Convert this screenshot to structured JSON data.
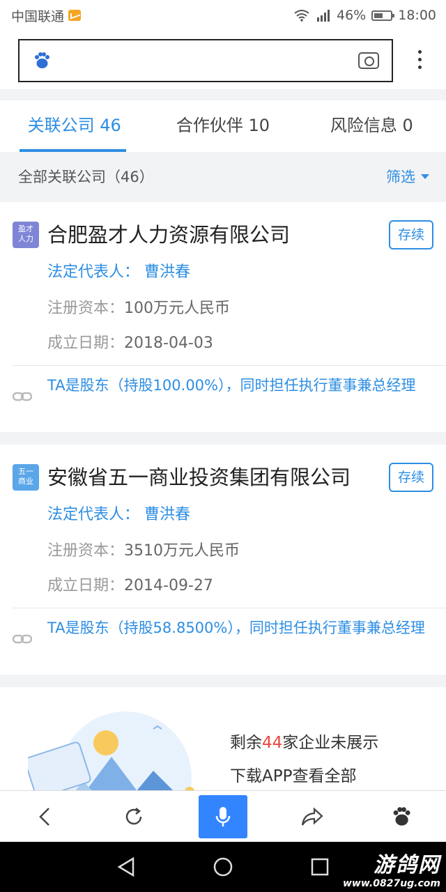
{
  "status_bar": {
    "carrier": "中国联通",
    "battery": "46%",
    "time": "18:00"
  },
  "tabs": [
    {
      "label": "关联公司 46"
    },
    {
      "label": "合作伙伴 10"
    },
    {
      "label": "风险信息 0"
    }
  ],
  "filter": {
    "summary": "全部关联公司（46）",
    "button": "筛选"
  },
  "companies": [
    {
      "logo_text_line1": "盈才",
      "logo_text_line2": "人力",
      "name": "合肥盈才人力资源有限公司",
      "status": "存续",
      "legal_rep": "法定代表人： 曹洪春",
      "capital_label": "注册资本：",
      "capital_value": "100万元人民币",
      "date_label": "成立日期：",
      "date_value": "2018-04-03",
      "relation": "TA是股东（持股100.00%），同时担任执行董事兼总经理"
    },
    {
      "logo_text_line1": "五一",
      "logo_text_line2": "商业",
      "name": "安徽省五一商业投资集团有限公司",
      "status": "存续",
      "legal_rep": "法定代表人： 曹洪春",
      "capital_label": "注册资本：",
      "capital_value": "3510万元人民币",
      "date_label": "成立日期：",
      "date_value": "2014-09-27",
      "relation": "TA是股东（持股58.8500%），同时担任执行董事兼总经理"
    }
  ],
  "promo": {
    "prefix": "剩余",
    "count": "44",
    "suffix": "家企业未展示",
    "line2": "下载APP查看全部"
  },
  "watermark": {
    "title": "游鸽网",
    "url": "www.0827ug.com"
  }
}
